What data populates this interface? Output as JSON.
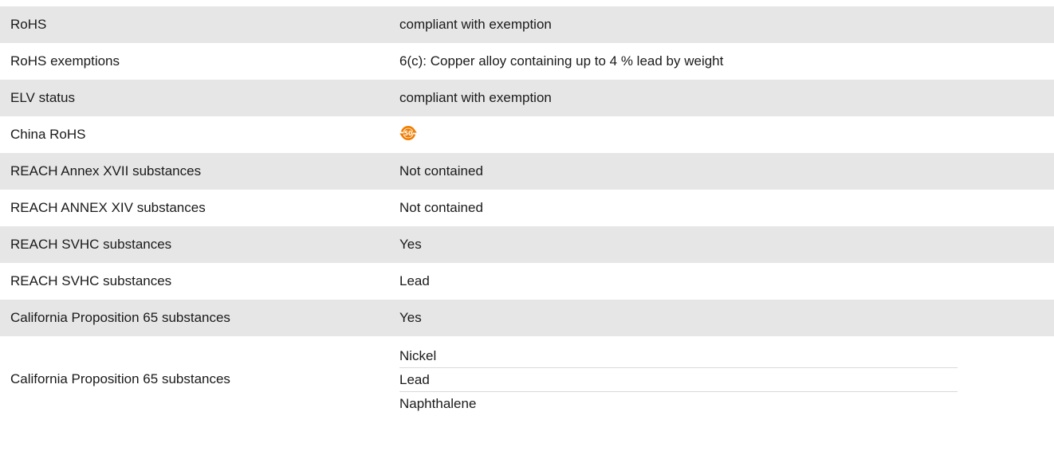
{
  "compliance_table": {
    "rows": [
      {
        "label": "RoHS",
        "value": "compliant with exemption"
      },
      {
        "label": "RoHS exemptions",
        "value": "6(c): Copper alloy containing up to 4 % lead by weight"
      },
      {
        "label": "ELV status",
        "value": "compliant with exemption"
      },
      {
        "label": "China RoHS",
        "icon": "china-rohs-50-icon",
        "icon_text": "50",
        "icon_color": "#f07d00"
      },
      {
        "label": "REACH Annex XVII substances",
        "value": "Not contained"
      },
      {
        "label": "REACH ANNEX XIV substances",
        "value": "Not contained"
      },
      {
        "label": "REACH SVHC substances",
        "value": "Yes"
      },
      {
        "label": "REACH SVHC substances",
        "value": "Lead"
      },
      {
        "label": "California Proposition 65 substances",
        "value": "Yes"
      },
      {
        "label": "California Proposition 65 substances",
        "values": [
          "Nickel",
          "Lead",
          "Naphthalene"
        ]
      }
    ]
  },
  "colors": {
    "row_shade": "#e6e6e6",
    "row_plain": "#ffffff",
    "text": "#1a1a1a",
    "divider": "#d9d9d9",
    "icon_orange": "#f07d00"
  }
}
